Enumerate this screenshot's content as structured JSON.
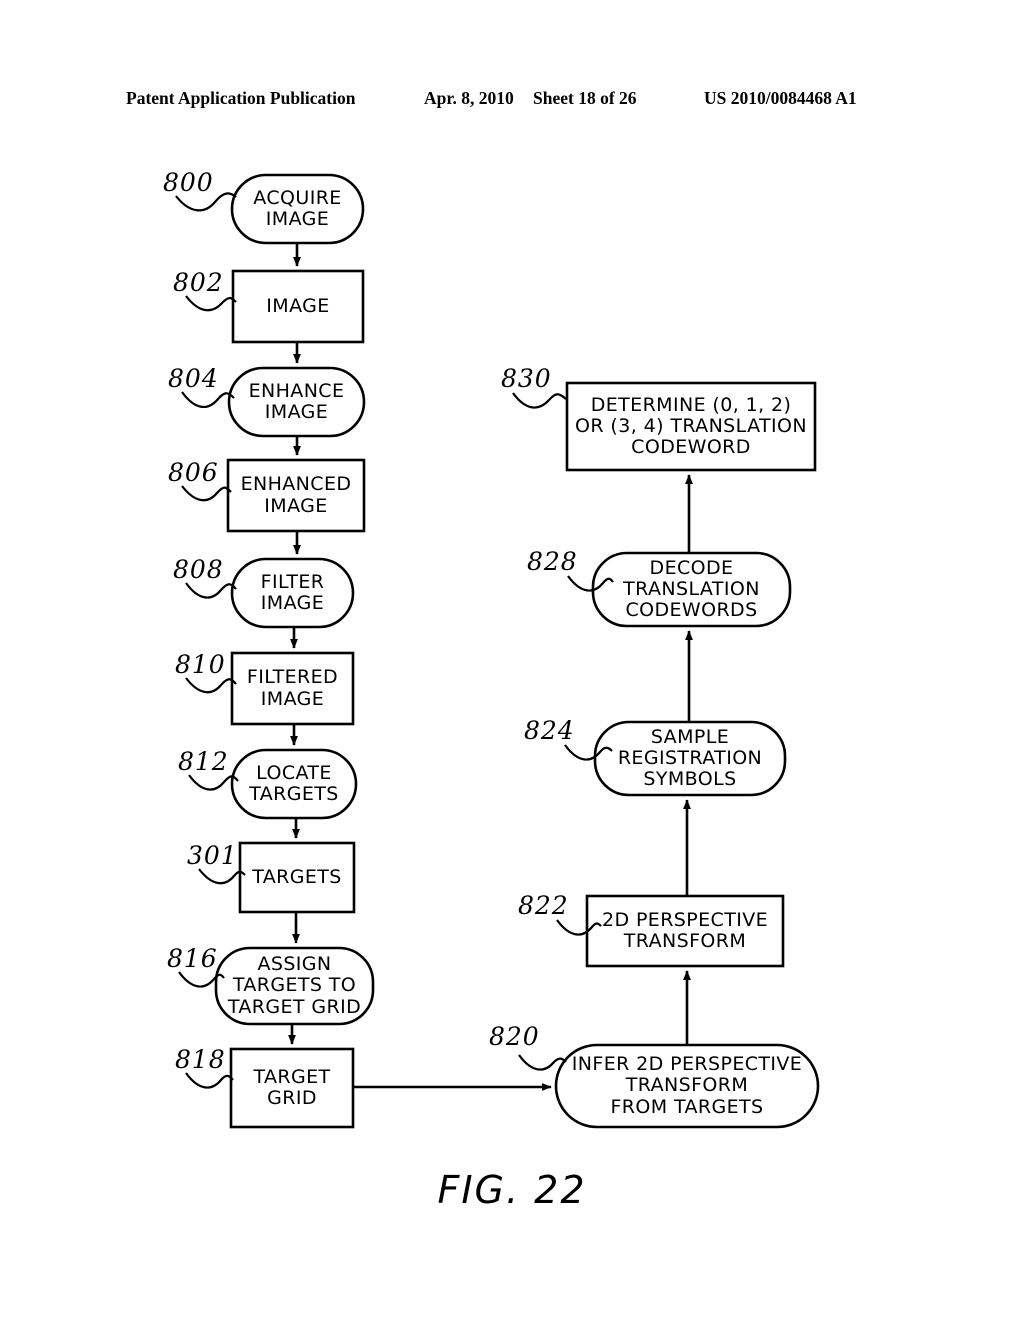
{
  "header": {
    "publication": "Patent Application Publication",
    "date": "Apr. 8, 2010",
    "sheet": "Sheet 18 of 26",
    "number": "US 2010/0084468 A1"
  },
  "figure": {
    "caption": "FIG. 22"
  },
  "nodes": {
    "n800": {
      "ref": "800",
      "lines": [
        "ACQUIRE",
        "IMAGE"
      ],
      "shape": "rounded"
    },
    "n802": {
      "ref": "802",
      "lines": [
        "IMAGE"
      ],
      "shape": "rect"
    },
    "n804": {
      "ref": "804",
      "lines": [
        "ENHANCE",
        "IMAGE"
      ],
      "shape": "rounded"
    },
    "n806": {
      "ref": "806",
      "lines": [
        "ENHANCED",
        "IMAGE"
      ],
      "shape": "rect"
    },
    "n808": {
      "ref": "808",
      "lines": [
        "FILTER",
        "IMAGE"
      ],
      "shape": "rounded"
    },
    "n810": {
      "ref": "810",
      "lines": [
        "FILTERED",
        "IMAGE"
      ],
      "shape": "rect"
    },
    "n812": {
      "ref": "812",
      "lines": [
        "LOCATE",
        "TARGETS"
      ],
      "shape": "rounded"
    },
    "n301": {
      "ref": "301",
      "lines": [
        "TARGETS"
      ],
      "shape": "rect"
    },
    "n816": {
      "ref": "816",
      "lines": [
        "ASSIGN",
        "TARGETS TO",
        "TARGET GRID"
      ],
      "shape": "rounded"
    },
    "n818": {
      "ref": "818",
      "lines": [
        "TARGET",
        "GRID"
      ],
      "shape": "rect"
    },
    "n820": {
      "ref": "820",
      "lines": [
        "INFER 2D PERSPECTIVE",
        "TRANSFORM",
        "FROM TARGETS"
      ],
      "shape": "rounded"
    },
    "n822": {
      "ref": "822",
      "lines": [
        "2D PERSPECTIVE",
        "TRANSFORM"
      ],
      "shape": "rect"
    },
    "n824": {
      "ref": "824",
      "lines": [
        "SAMPLE",
        "REGISTRATION",
        "SYMBOLS"
      ],
      "shape": "rounded"
    },
    "n828": {
      "ref": "828",
      "lines": [
        "DECODE",
        "TRANSLATION",
        "CODEWORDS"
      ],
      "shape": "rounded"
    },
    "n830": {
      "ref": "830",
      "lines": [
        "DETERMINE (0, 1, 2)",
        "OR (3, 4) TRANSLATION",
        "CODEWORD"
      ],
      "shape": "rect"
    }
  }
}
